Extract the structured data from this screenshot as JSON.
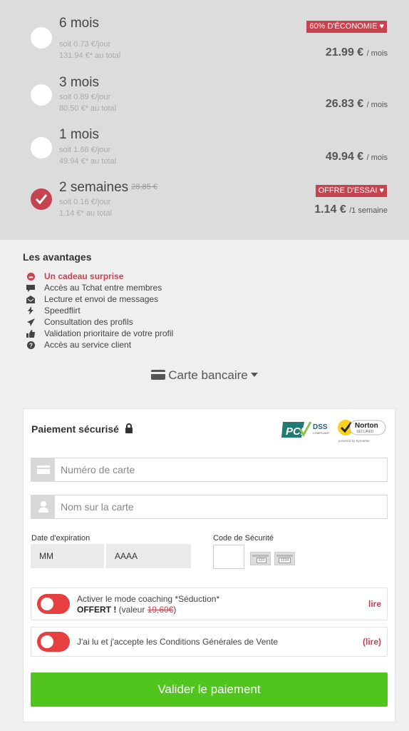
{
  "plans": [
    {
      "title": "6 mois",
      "per_day": "soit 0.73 €/jour",
      "total": "131.94 €* au total",
      "badge": "60% D'ÉCONOMIE",
      "price": "21.99 €",
      "unit": "/ mois",
      "checked": false
    },
    {
      "title": "3 mois",
      "per_day": "soit 0.89 €/jour",
      "total": "80.50 €* au total",
      "badge": "",
      "price": "26.83 €",
      "unit": "/ mois",
      "checked": false
    },
    {
      "title": "1 mois",
      "per_day": "soit 1.66 €/jour",
      "total": "49.94 €* au total",
      "badge": "",
      "price": "49.94 €",
      "unit": "/ mois",
      "checked": false
    },
    {
      "title": "2 semaines",
      "old_price": "28.85 €",
      "per_day": "soit 0.16 €/jour",
      "total": "1.14 €* au total",
      "badge": "OFFRE D'ESSAI",
      "price": "1.14 €",
      "unit": "/1 semaine",
      "checked": true
    }
  ],
  "advantages": {
    "title": "Les avantages",
    "items": [
      {
        "label": "Un cadeau surprise",
        "icon": "smile-icon",
        "highlight": true
      },
      {
        "label": "Accès au Tchat entre membres",
        "icon": "chat-icon",
        "highlight": false
      },
      {
        "label": "Lecture et envoi de messages",
        "icon": "mail-icon",
        "highlight": false
      },
      {
        "label": "Speedflirt",
        "icon": "bolt-icon",
        "highlight": false
      },
      {
        "label": "Consultation des profils",
        "icon": "send-icon",
        "highlight": false
      },
      {
        "label": "Validation prioritaire de votre profil",
        "icon": "thumbs-up-icon",
        "highlight": false
      },
      {
        "label": "Accès au service client",
        "icon": "question-icon",
        "highlight": false
      }
    ]
  },
  "payment_method": {
    "label": "Carte bancaire"
  },
  "secure": {
    "title": "Paiement sécurisé",
    "pci_label": "DSS",
    "pci_sub": "COMPLIANT",
    "norton_label": "Norton",
    "norton_sub": "SECURED",
    "norton_powered": "powered by Symantec"
  },
  "form": {
    "card_number_placeholder": "Numéro de carte",
    "card_name_placeholder": "Nom sur la carte",
    "expiration_label": "Date d'expiration",
    "month_placeholder": "MM",
    "year_placeholder": "AAAA",
    "cvc_label": "Code de Sécurité",
    "cvc_card1": "123",
    "cvc_card2": "1234"
  },
  "coaching": {
    "text": "Activer le mode coaching *Séduction*",
    "offered": "OFFERT !",
    "value_prefix": "(valeur ",
    "value_old": "19,60€",
    "value_suffix": ")",
    "link": "lire",
    "enabled": false
  },
  "cgv": {
    "text": "J'ai lu et j'accepte les Conditions Générales de Vente",
    "link": "(lire)",
    "enabled": false
  },
  "submit_label": "Valider le paiement",
  "colors": {
    "accent": "#c6444f",
    "toggle": "#e5403f",
    "submit": "#51c41e"
  }
}
